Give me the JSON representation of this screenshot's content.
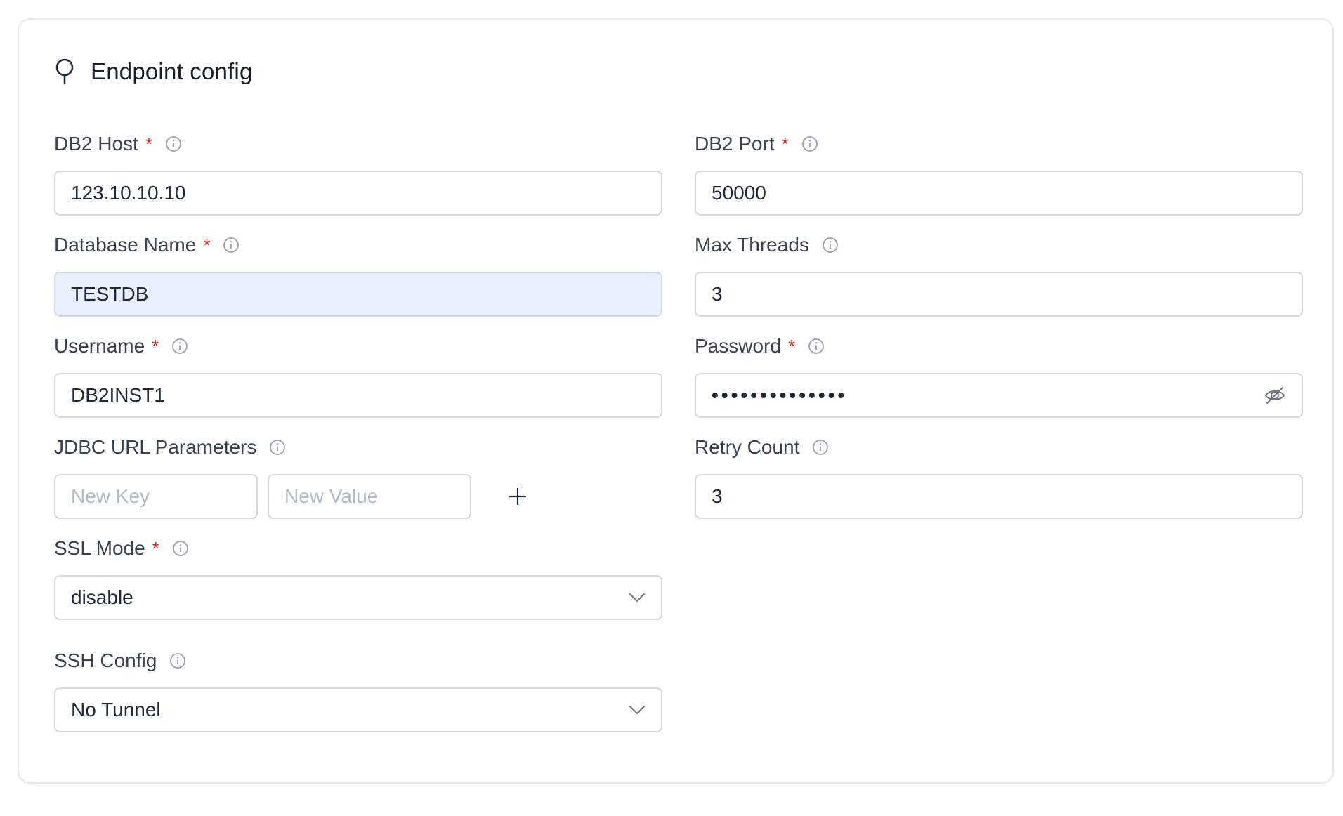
{
  "card": {
    "title": "Endpoint config",
    "icon": "pin-icon"
  },
  "fields": {
    "db2_host": {
      "label": "DB2 Host",
      "required": "*",
      "value": "123.10.10.10"
    },
    "db2_port": {
      "label": "DB2 Port",
      "required": "*",
      "value": "50000"
    },
    "database_name": {
      "label": "Database Name",
      "required": "*",
      "value": "TESTDB"
    },
    "max_threads": {
      "label": "Max Threads",
      "value": "3"
    },
    "username": {
      "label": "Username",
      "required": "*",
      "value": "DB2INST1"
    },
    "password": {
      "label": "Password",
      "required": "*",
      "value": "••••••••••••••"
    },
    "jdbc_params": {
      "label": "JDBC URL Parameters",
      "key_placeholder": "New Key",
      "value_placeholder": "New Value"
    },
    "retry_count": {
      "label": "Retry Count",
      "value": "3"
    },
    "ssl_mode": {
      "label": "SSL Mode",
      "required": "*",
      "value": "disable"
    },
    "ssh_config": {
      "label": "SSH Config",
      "value": "No Tunnel"
    }
  },
  "colors": {
    "required": "#dc2626",
    "autofill_bg": "#e8f0fe",
    "border": "#d5d9df"
  }
}
